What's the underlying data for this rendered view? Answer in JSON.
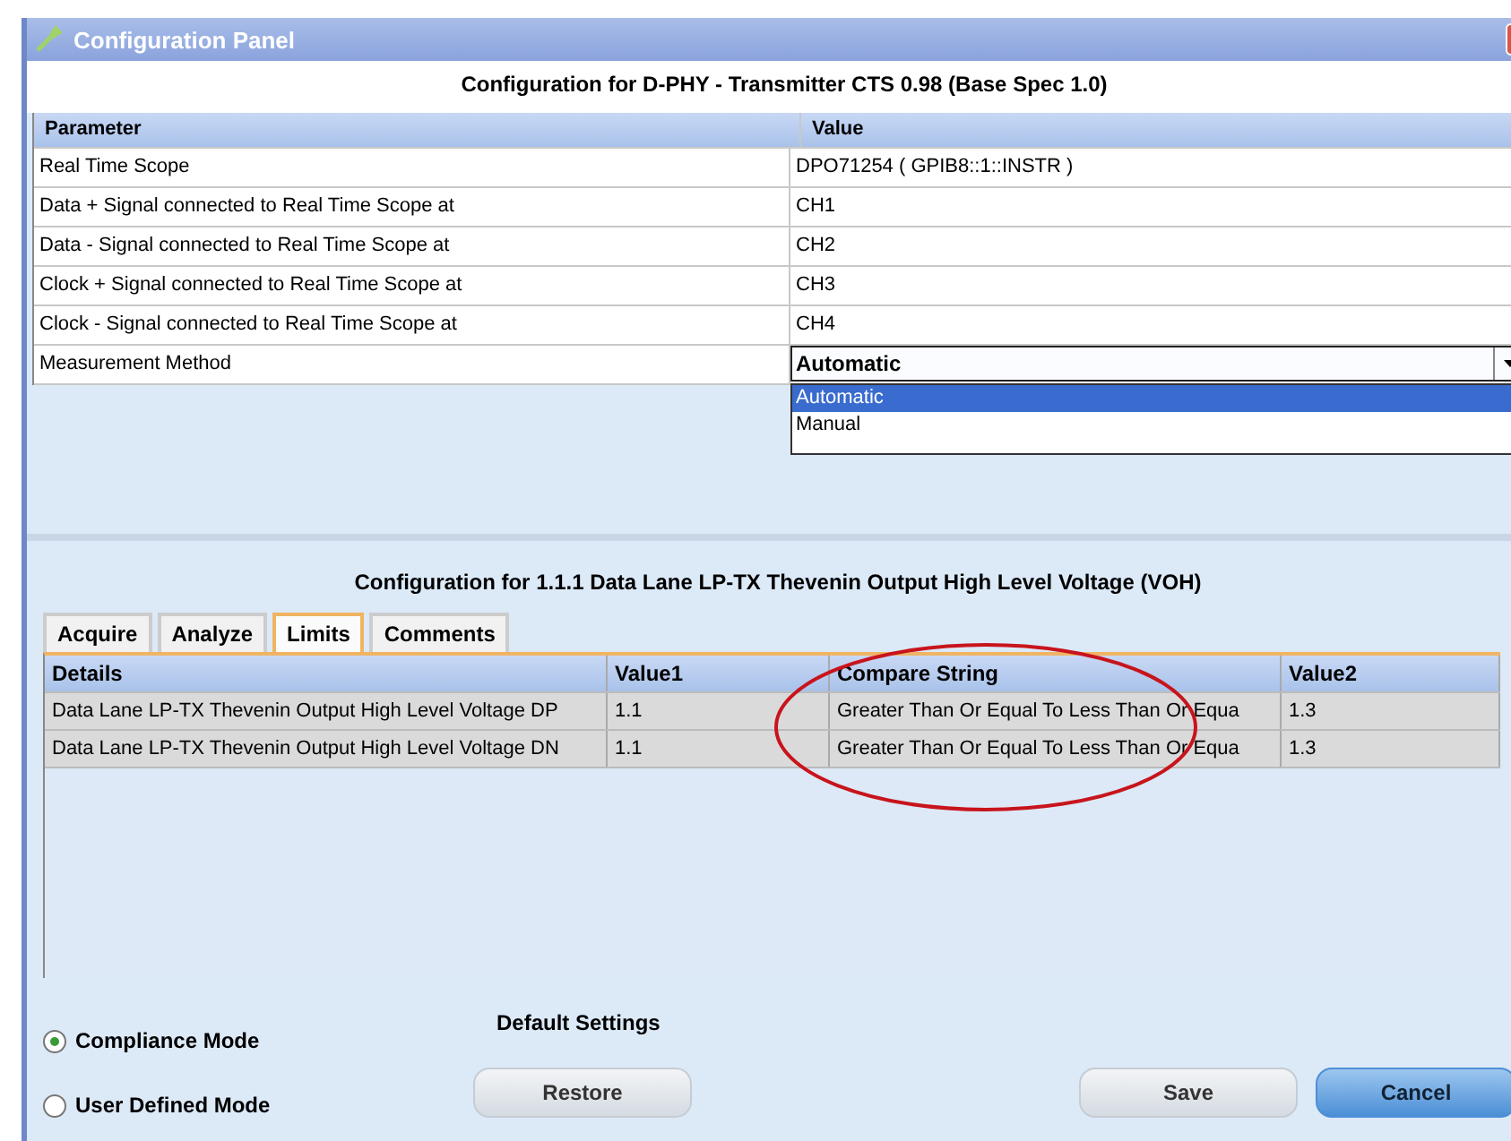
{
  "window": {
    "title": "Configuration Panel"
  },
  "top_section": {
    "heading": "Configuration for D-PHY - Transmitter CTS 0.98 (Base Spec 1.0)",
    "columns": [
      "Parameter",
      "Value"
    ],
    "rows": [
      {
        "kind": "text",
        "parameter": "Real Time Scope",
        "value": "DPO71254 ( GPIB8::1::INSTR )"
      },
      {
        "kind": "text",
        "parameter": "Data + Signal connected to Real Time Scope at",
        "value": "CH1"
      },
      {
        "kind": "text",
        "parameter": "Data - Signal connected to Real Time Scope at",
        "value": "CH2"
      },
      {
        "kind": "text",
        "parameter": "Clock + Signal connected to Real Time Scope at",
        "value": "CH3"
      },
      {
        "kind": "text",
        "parameter": "Clock - Signal connected to Real Time Scope at",
        "value": "CH4"
      },
      {
        "kind": "dropdown",
        "parameter": "Measurement Method",
        "value": "Automatic",
        "expanded": true,
        "options": [
          {
            "label": "Automatic",
            "selected": true
          },
          {
            "label": "Manual",
            "selected": false
          }
        ]
      }
    ]
  },
  "bottom_section": {
    "heading": "Configuration for 1.1.1 Data Lane LP-TX Thevenin Output High Level Voltage (VOH)",
    "tabs": [
      {
        "label": "Acquire",
        "selected": false
      },
      {
        "label": "Analyze",
        "selected": false
      },
      {
        "label": "Limits",
        "selected": true
      },
      {
        "label": "Comments",
        "selected": false
      }
    ],
    "columns": [
      "Details",
      "Value1",
      "Compare String",
      "Value2"
    ],
    "rows": [
      [
        "Data Lane LP-TX Thevenin Output High Level Voltage DP",
        "1.1",
        "Greater Than Or Equal To Less Than Or Equa",
        "1.3"
      ],
      [
        "Data Lane LP-TX Thevenin Output High Level Voltage DN",
        "1.1",
        "Greater Than Or Equal To Less Than Or Equa",
        "1.3"
      ]
    ]
  },
  "modes": [
    {
      "label": "Compliance Mode",
      "selected": true
    },
    {
      "label": "User Defined Mode",
      "selected": false
    }
  ],
  "default_settings": {
    "label": "Default Settings",
    "button": "Restore"
  },
  "buttons": [
    {
      "label": "Save",
      "kind": "normal"
    },
    {
      "label": "Cancel",
      "kind": "primary"
    }
  ]
}
